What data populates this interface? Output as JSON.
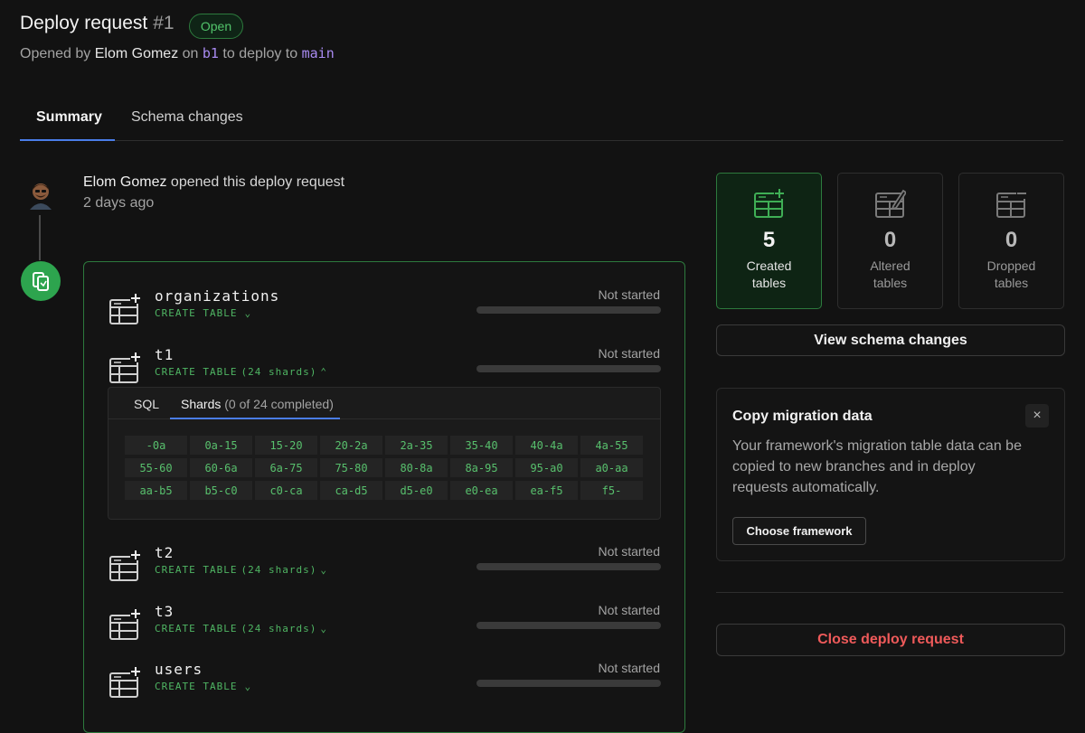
{
  "header": {
    "title": "Deploy request",
    "number": "#1",
    "status": "Open",
    "subtitle": {
      "prefix": "Opened by",
      "author": "Elom Gomez",
      "on": "on",
      "from_branch": "b1",
      "to_text": "to deploy to",
      "to_branch": "main"
    }
  },
  "tabs": [
    {
      "label": "Summary"
    },
    {
      "label": "Schema changes"
    }
  ],
  "event": {
    "author": "Elom Gomez",
    "action": "opened this deploy request",
    "time": "2 days ago"
  },
  "tables": [
    {
      "name": "organizations",
      "op": "CREATE TABLE",
      "shards": "",
      "status": "Not started",
      "progress": 0
    },
    {
      "name": "t1",
      "op": "CREATE TABLE",
      "shards": "(24 shards)",
      "status": "Not started",
      "progress": 0,
      "expanded": true
    },
    {
      "name": "t2",
      "op": "CREATE TABLE",
      "shards": "(24 shards)",
      "status": "Not started",
      "progress": 0
    },
    {
      "name": "t3",
      "op": "CREATE TABLE",
      "shards": "(24 shards)",
      "status": "Not started",
      "progress": 0
    },
    {
      "name": "users",
      "op": "CREATE TABLE",
      "shards": "",
      "status": "Not started",
      "progress": 0
    }
  ],
  "shard_panel": {
    "tab_sql": "SQL",
    "tab_shards": "Shards",
    "tab_shards_progress": "(0 of 24 completed)",
    "shards": [
      "-0a",
      "0a-15",
      "15-20",
      "20-2a",
      "2a-35",
      "35-40",
      "40-4a",
      "4a-55",
      "55-60",
      "60-6a",
      "6a-75",
      "75-80",
      "80-8a",
      "8a-95",
      "95-a0",
      "a0-aa",
      "aa-b5",
      "b5-c0",
      "c0-ca",
      "ca-d5",
      "d5-e0",
      "e0-ea",
      "ea-f5",
      "f5-"
    ]
  },
  "stats": [
    {
      "value": "5",
      "line1": "Created",
      "line2": "tables",
      "icon": "table-plus-icon"
    },
    {
      "value": "0",
      "line1": "Altered",
      "line2": "tables",
      "icon": "table-edit-icon"
    },
    {
      "value": "0",
      "line1": "Dropped",
      "line2": "tables",
      "icon": "table-minus-icon"
    }
  ],
  "actions": {
    "view_schema": "View schema changes",
    "close_request": "Close deploy request"
  },
  "copy_card": {
    "title": "Copy migration data",
    "close": "×",
    "description": "Your framework's migration table data can be copied to new branches and in deploy requests automatically.",
    "button": "Choose framework"
  },
  "colors": {
    "accent_green": "#2da44e",
    "accent_blue": "#4a7de8",
    "branch_purple": "#a98bf2",
    "danger_red": "#ef5a5a"
  }
}
